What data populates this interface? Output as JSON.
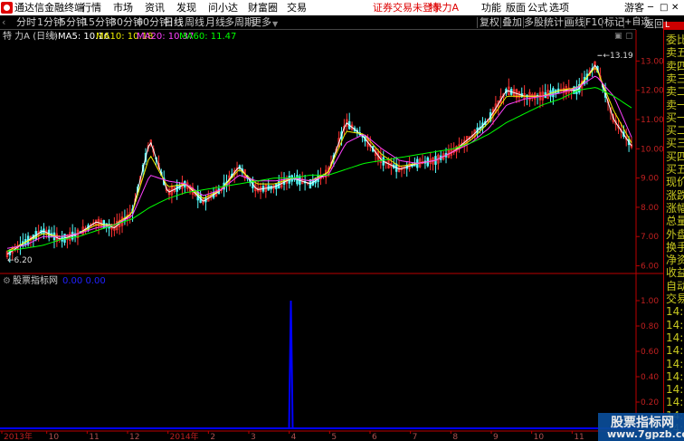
{
  "titlebar": {
    "app_name": "通达信金融终端",
    "menu": [
      "行情",
      "市场",
      "资讯",
      "发现",
      "问小达",
      "财富圈",
      "交易"
    ],
    "notice": "证券交易未登录",
    "stock_name": "特 力A",
    "right_menu": [
      "功能",
      "版面",
      "公式",
      "选项"
    ],
    "user": "游客"
  },
  "toolbar": {
    "periods": [
      "分时",
      "1分钟",
      "5分钟",
      "15分钟",
      "30分钟",
      "60分钟",
      "日线",
      "周线",
      "月线",
      "多周期",
      "更多"
    ],
    "active_period": "日线",
    "actions": [
      "复权",
      "叠加",
      "多股",
      "统计",
      "画线",
      "F10",
      "标记",
      "+自选",
      "返回"
    ]
  },
  "indicator_bar": {
    "title": "特 力A (日线)",
    "ma5": "MA5: 10.16",
    "ma10": "MA10: 10.18",
    "ma20": "MA20: 10.37",
    "ma60": "MA60: 11.47"
  },
  "sub_indicator": {
    "title": "股票指标网",
    "values": "0.00  0.00"
  },
  "sidebar": {
    "tab": "L",
    "items": [
      "委比",
      "卖五",
      "卖四",
      "卖三",
      "卖二",
      "卖一",
      "买一",
      "买二",
      "买三",
      "买四",
      "买五",
      "现价",
      "涨跌",
      "涨幅",
      "总量",
      "外盘",
      "换手",
      "净资",
      "收益",
      "自动",
      "交易",
      "14:5",
      "14:5",
      "14:5",
      "14:5",
      "14:5",
      "14:5",
      "14:5",
      "14:5",
      "14:5",
      "14:5"
    ]
  },
  "watermark": {
    "line1": "股票指标网",
    "line2": "www.7gpzb.com"
  },
  "colors": {
    "ma5": "#ffffff",
    "ma10": "#f0f000",
    "ma20": "#ff40ff",
    "ma60": "#00ff00",
    "up": "#ff3232",
    "down": "#54fcfc",
    "signal": "#0000ff"
  },
  "chart_data": [
    {
      "type": "candlestick",
      "title": "特 力A (日线)",
      "y_axis_labels": [
        "13.00",
        "12.00",
        "11.00",
        "10.00",
        "9.00",
        "8.00",
        "7.00",
        "6.00"
      ],
      "ylim": [
        5.8,
        13.6
      ],
      "x_axis_labels": [
        "2013年",
        "10",
        "11",
        "12",
        "2014年",
        "2",
        "3",
        "4",
        "5",
        "6",
        "7",
        "8",
        "9",
        "10",
        "11",
        "12"
      ],
      "annotations": {
        "high_label": "13.19",
        "low_label": "6.20"
      },
      "series": [
        {
          "name": "MA5",
          "values": [
            6.4,
            6.8,
            7.2,
            6.9,
            7.1,
            7.5,
            7.3,
            7.8,
            10.3,
            8.5,
            8.8,
            8.2,
            8.6,
            9.4,
            8.6,
            8.7,
            9.0,
            8.8,
            9.2,
            10.9,
            10.4,
            9.6,
            9.3,
            9.5,
            9.6,
            9.9,
            10.4,
            11.0,
            12.0,
            11.8,
            11.8,
            12.0,
            12.0,
            12.9,
            11.0,
            10.1
          ]
        },
        {
          "name": "MA10",
          "values": [
            6.5,
            6.8,
            7.1,
            7.0,
            7.1,
            7.4,
            7.4,
            7.8,
            9.8,
            8.7,
            8.8,
            8.3,
            8.6,
            9.3,
            8.8,
            8.8,
            9.0,
            8.9,
            9.2,
            10.6,
            10.5,
            9.8,
            9.4,
            9.5,
            9.6,
            9.9,
            10.3,
            10.9,
            11.8,
            11.8,
            11.8,
            12.0,
            12.1,
            12.8,
            11.3,
            10.2
          ]
        },
        {
          "name": "MA20",
          "values": [
            6.6,
            6.7,
            7.0,
            7.0,
            7.1,
            7.3,
            7.4,
            7.7,
            9.1,
            8.9,
            8.8,
            8.4,
            8.6,
            9.1,
            8.9,
            8.9,
            9.0,
            8.9,
            9.1,
            10.2,
            10.5,
            10.0,
            9.6,
            9.5,
            9.6,
            9.9,
            10.2,
            10.7,
            11.5,
            11.7,
            11.8,
            11.9,
            12.1,
            12.5,
            11.8,
            10.4
          ]
        },
        {
          "name": "MA60",
          "values": [
            6.5,
            6.6,
            6.7,
            6.9,
            7.0,
            7.2,
            7.4,
            7.6,
            8.0,
            8.3,
            8.5,
            8.6,
            8.7,
            8.8,
            8.9,
            9.0,
            9.0,
            9.1,
            9.1,
            9.3,
            9.5,
            9.6,
            9.7,
            9.8,
            9.9,
            10.0,
            10.2,
            10.5,
            10.9,
            11.2,
            11.5,
            11.7,
            12.0,
            12.1,
            11.8,
            11.4
          ]
        }
      ],
      "grid": false
    },
    {
      "type": "bar",
      "title": "股票指标网",
      "y_axis_labels": [
        "1.00",
        "0.80",
        "0.60",
        "0.40",
        "0.20"
      ],
      "ylim": [
        0,
        1.1
      ],
      "spike_position_fraction": 0.455,
      "spike_value": 1.0
    }
  ]
}
